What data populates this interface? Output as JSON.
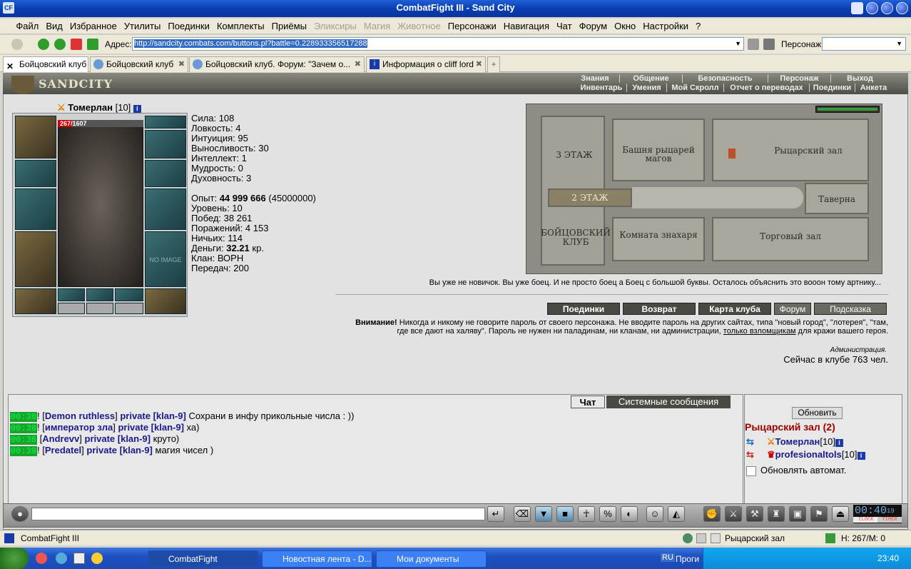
{
  "window": {
    "title": "CombatFight III - Sand City",
    "icon_label": "CF"
  },
  "menu": [
    "Файл",
    "Вид",
    "Избранное",
    "Утилиты",
    "Поединки",
    "Комплекты",
    "Приёмы",
    "Эликсиры",
    "Магия",
    "Животное",
    "Персонажи",
    "Навигация",
    "Чат",
    "Форум",
    "Окно",
    "Настройки",
    "?"
  ],
  "menu_disabled": [
    "Эликсиры",
    "Магия",
    "Животное"
  ],
  "toolbar": {
    "address_label": "Адрес:",
    "address_value": "http://sandcity.combats.com/buttons.pl?battle=0.228933356517288",
    "persona_label": "Персонаж:"
  },
  "tabs": [
    {
      "label": "Бойцовский клуб"
    },
    {
      "label": "Бойцовский клуб"
    },
    {
      "label": "Бойцовский клуб. Форум: \"Зачем о..."
    },
    {
      "label": "Информация о cliff lord"
    }
  ],
  "game": {
    "logo": "SANDCITY",
    "topnav1": [
      "Знания",
      "Общение",
      "Безопасность",
      "Персонаж",
      "Выход"
    ],
    "topnav2": [
      "Инвентарь",
      "Умения",
      "Мой Скролл",
      "Отчет о переводах",
      "Поединки",
      "Анкета"
    ],
    "character": {
      "name": "Томерлан",
      "level": "[10]",
      "hp": "267",
      "hp_max": "/1607",
      "hp_fraction": 0.166,
      "no_image": "NO IMAGE"
    },
    "stats": [
      {
        "label": "Сила:",
        "value": "108"
      },
      {
        "label": "Ловкость:",
        "value": "4"
      },
      {
        "label": "Интуиция:",
        "value": "95"
      },
      {
        "label": "Выносливость:",
        "value": "30"
      },
      {
        "label": "Интеллект:",
        "value": "1"
      },
      {
        "label": "Мудрость:",
        "value": "0"
      },
      {
        "label": "Духовность:",
        "value": "3"
      }
    ],
    "exp": {
      "label": "Опыт:",
      "value": "44 999 666",
      "next": "(45000000)"
    },
    "info": [
      {
        "label": "Уровень:",
        "value": "10"
      },
      {
        "label": "Побед:",
        "value": "38 261"
      },
      {
        "label": "Поражений:",
        "value": "4 153"
      },
      {
        "label": "Ничьих:",
        "value": "114"
      }
    ],
    "money": {
      "label": "Деньги:",
      "value": "32.21",
      "unit": "кр."
    },
    "clan": {
      "label": "Клан:",
      "value": "ВОРН"
    },
    "transfers": {
      "label": "Передач:",
      "value": "200"
    },
    "map": {
      "floor3": "3 ЭТАЖ",
      "floor2": "2 ЭТАЖ",
      "club": "БОЙЦОВСКИЙ КЛУБ",
      "tower": "Башня рыцарей магов",
      "knight_hall": "Рыцарский зал",
      "tavern": "Таверна",
      "healer": "Комната знахаря",
      "trade": "Торговый зал"
    },
    "quote": "Вы уже не новичок. Вы уже боец. И не просто боец а Боец с большой буквы. Осталось объяснить это вооон тому артнику...",
    "buttons": [
      "Поединки",
      "Возврат",
      "Карта клуба",
      "Форум",
      "Подсказка"
    ],
    "warning_bold": "Внимание!",
    "warning_text1": " Никогда и никому не говорите пароль от своего персонажа. Не вводите пароль на других сайтах, типа \"новый город\", \"лотерея\", \"там, где все дают на халяву\". Пароль не нужен ни паладинам, ни кланам, ни администрации, ",
    "warning_link": "только взломщикам",
    "warning_text2": " для кражи вашего героя.",
    "admin": "Администрация.",
    "online": "Сейчас в клубе 763 чел."
  },
  "chat": {
    "tab_chat": "Чат",
    "tab_system": "Системные сообщения",
    "messages": [
      {
        "time": "00:38",
        "nick": "Demon ruthless",
        "to": "private [klan-9]",
        "text": "Сохрани в инфу прикольные числа : ))"
      },
      {
        "time": "00:38",
        "nick": "император зла",
        "to": "private [klan-9]",
        "text": "ха)"
      },
      {
        "time": "00:38",
        "nick": "Andrevv",
        "to": "private [klan-9]",
        "text": "круто)"
      },
      {
        "time": "00:39",
        "nick": "Predatel",
        "to": "private [klan-9]",
        "text": "магия чисел )"
      }
    ]
  },
  "room": {
    "refresh": "Обновить",
    "title": "Рыцарский зал (2)",
    "players": [
      {
        "name": "Томерлан",
        "level": "[10]"
      },
      {
        "name": "profesionaltols",
        "level": "[10]"
      }
    ],
    "auto_refresh": "Обновлять автомат."
  },
  "clock": {
    "time": "00:40",
    "sec": "19",
    "label_clock": "CLOCK",
    "label_timer": "TIMER"
  },
  "statusbar": {
    "app": "CombatFight III",
    "location": "Рыцарский зал",
    "hp": "H: 267/M: 0"
  },
  "taskbar": {
    "items": [
      "CombatFight",
      "Новостная лента - D...",
      "Мои документы"
    ],
    "lang": "RU",
    "progs": "Проги",
    "time": "23:40"
  }
}
